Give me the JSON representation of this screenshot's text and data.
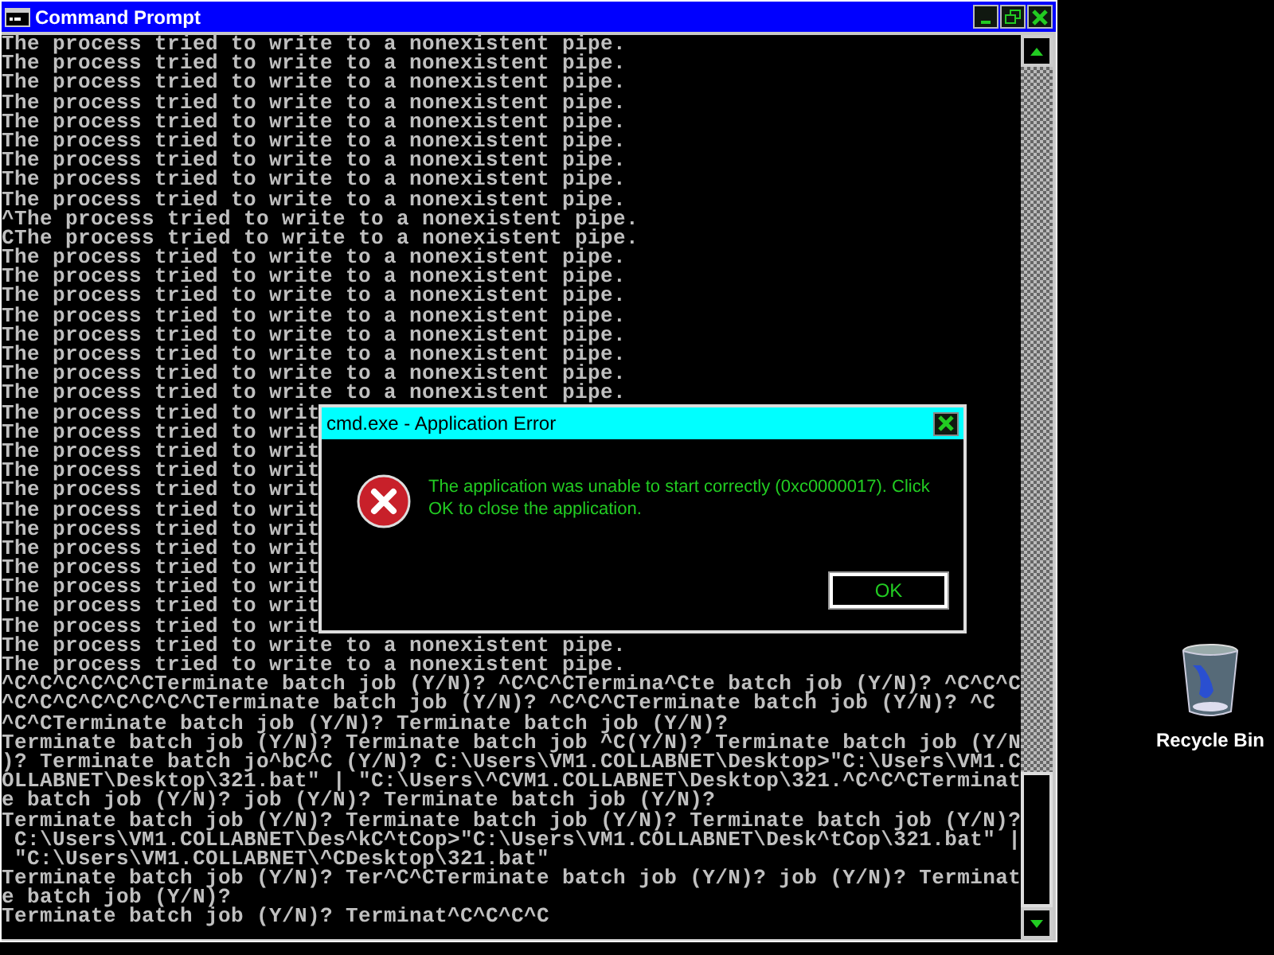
{
  "window": {
    "title": "Command Prompt",
    "console_lines": [
      "The process tried to write to a nonexistent pipe.",
      "The process tried to write to a nonexistent pipe.",
      "The process tried to write to a nonexistent pipe.",
      "The process tried to write to a nonexistent pipe.",
      "The process tried to write to a nonexistent pipe.",
      "The process tried to write to a nonexistent pipe.",
      "The process tried to write to a nonexistent pipe.",
      "The process tried to write to a nonexistent pipe.",
      "The process tried to write to a nonexistent pipe.",
      "^The process tried to write to a nonexistent pipe.",
      "CThe process tried to write to a nonexistent pipe.",
      "The process tried to write to a nonexistent pipe.",
      "The process tried to write to a nonexistent pipe.",
      "The process tried to write to a nonexistent pipe.",
      "The process tried to write to a nonexistent pipe.",
      "The process tried to write to a nonexistent pipe.",
      "The process tried to write to a nonexistent pipe.",
      "The process tried to write to a nonexistent pipe.",
      "The process tried to write to a nonexistent pipe.",
      "The process tried to writ",
      "The process tried to writ",
      "The process tried to writ",
      "The process tried to writ",
      "The process tried to writ",
      "The process tried to writ",
      "The process tried to writ",
      "The process tried to writ",
      "The process tried to writ",
      "The process tried to writ",
      "The process tried to writ",
      "The process tried to writ",
      "The process tried to write to a nonexistent pipe.",
      "The process tried to write to a nonexistent pipe.",
      "^C^C^C^C^C^CTerminate batch job (Y/N)? ^C^C^CTermina^Cte batch job (Y/N)? ^C^C^C",
      "^C^C^C^C^C^C^C^CTerminate batch job (Y/N)? ^C^C^CTerminate batch job (Y/N)? ^C",
      "^C^CTerminate batch job (Y/N)? Terminate batch job (Y/N)?",
      "Terminate batch job (Y/N)? Terminate batch job ^C(Y/N)? Terminate batch job (Y/N",
      ")? Terminate batch jo^bC^C (Y/N)? C:\\Users\\VM1.COLLABNET\\Desktop>\"C:\\Users\\VM1.C",
      "OLLABNET\\Desktop\\321.bat\" | \"C:\\Users\\^CVM1.COLLABNET\\Desktop\\321.^C^C^CTerminat",
      "e batch job (Y/N)? job (Y/N)? Terminate batch job (Y/N)?",
      "Terminate batch job (Y/N)? Terminate batch job (Y/N)? Terminate batch job (Y/N)?",
      " C:\\Users\\VM1.COLLABNET\\Des^kC^tCop>\"C:\\Users\\VM1.COLLABNET\\Desk^tCop\\321.bat\" |",
      " \"C:\\Users\\VM1.COLLABNET\\^CDesktop\\321.bat\"",
      "Terminate batch job (Y/N)? Ter^C^CTerminate batch job (Y/N)? job (Y/N)? Terminat",
      "e batch job (Y/N)?",
      "Terminate batch job (Y/N)? Terminat^C^C^C^C"
    ]
  },
  "dialog": {
    "title": "cmd.exe - Application Error",
    "message": "The application was unable to start correctly (0xc0000017). Click OK to close the application.",
    "button": "OK"
  },
  "desktop_icons": [
    {
      "label": "Recycle Bin"
    }
  ]
}
